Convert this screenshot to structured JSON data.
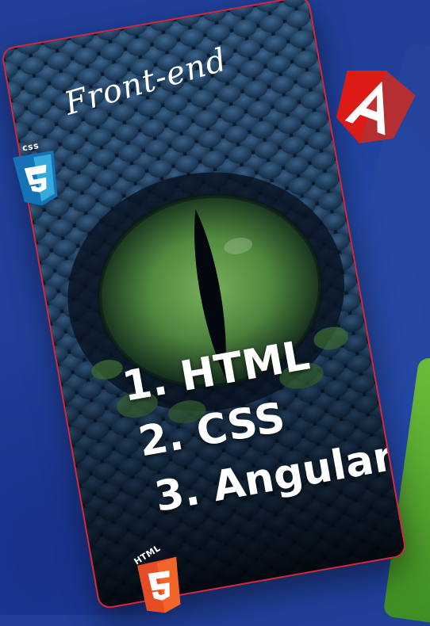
{
  "card": {
    "title": "Front-end",
    "items": [
      {
        "label": "1. HTML"
      },
      {
        "label": "2. CSS"
      },
      {
        "label": "3. Angular"
      }
    ]
  },
  "logos": {
    "angular": {
      "icon": "angular-logo-icon",
      "color": "#dd1b16"
    },
    "css": {
      "icon": "css3-logo-icon",
      "badge": "css",
      "color": "#2965f1"
    },
    "html": {
      "icon": "html5-logo-icon",
      "badge": "HTML",
      "color": "#e44d26"
    }
  },
  "colors": {
    "background": "#1f3f98",
    "card_border": "#d6283b",
    "eye": "#5fa045"
  }
}
